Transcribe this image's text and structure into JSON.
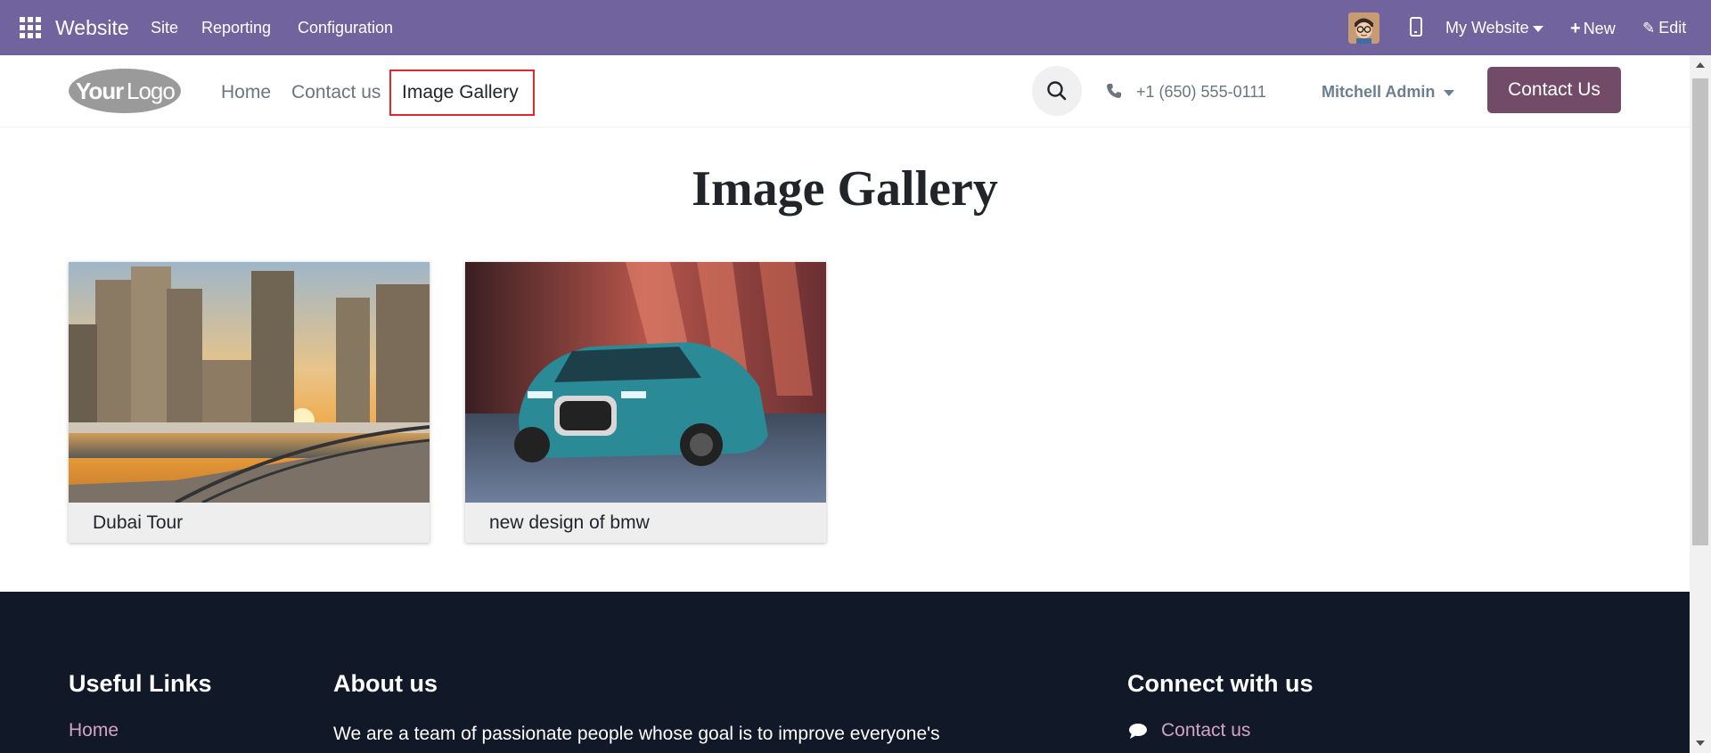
{
  "topbar": {
    "app_name": "Website",
    "menus": [
      "Site",
      "Reporting",
      "Configuration"
    ],
    "website_switcher": "My Website",
    "new_label": "New",
    "edit_label": "Edit",
    "bg_color": "#71639e"
  },
  "header": {
    "logo_text": "YourLogo",
    "nav": [
      "Home",
      "Contact us"
    ],
    "active_nav": "Image Gallery",
    "phone": "+1 (650) 555-0111",
    "user": "Mitchell Admin",
    "cta": "Contact Us",
    "cta_color": "#714b67"
  },
  "main": {
    "title": "Image Gallery",
    "cards": [
      {
        "caption": "Dubai Tour",
        "image": "dubai-skyline-sunset"
      },
      {
        "caption": "new design of bmw",
        "image": "teal-bmw-suv"
      }
    ]
  },
  "footer": {
    "useful_links_title": "Useful Links",
    "useful_links": [
      "Home"
    ],
    "about_title": "About us",
    "about_text": "We are a team of passionate people whose goal is to improve everyone's",
    "connect_title": "Connect with us",
    "connect_links": [
      "Contact us"
    ],
    "link_color": "#d3a3c5"
  }
}
